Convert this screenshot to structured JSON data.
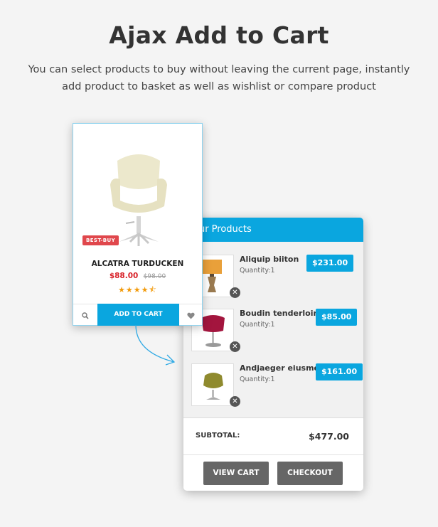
{
  "header": {
    "title": "Ajax Add to Cart",
    "subtitle_line1": "You can select products to buy without leaving the current page, instantly",
    "subtitle_line2": "add product to basket as well as wishlist or compare product"
  },
  "product_card": {
    "badge": "BEST-BUY",
    "name": "ALCATRA TURDUCKEN",
    "price": "$88.00",
    "old_price": "$98.00",
    "rating": 4.5,
    "rating_max": 5,
    "stars_display": "★★★★⯪",
    "add_to_cart_label": "ADD TO CART",
    "search_icon": "search-icon",
    "wishlist_icon": "heart-icon"
  },
  "cart": {
    "header_title": "our Products",
    "items": [
      {
        "name": "Aliquip biiton",
        "quantity": "Quantity:1",
        "price": "$231.00",
        "thumb": "lamp"
      },
      {
        "name": "Boudin tenderloin",
        "quantity": "Quantity:1",
        "price": "$85.00",
        "thumb": "red-chair"
      },
      {
        "name": "Andjaeger eiusmo",
        "quantity": "Quantity:1",
        "price": "$161.00",
        "thumb": "olive-chair"
      }
    ],
    "remove_glyph": "✕",
    "subtotal_label": "SUBTOTAL:",
    "subtotal_value": "$477.00",
    "view_cart_label": "VIEW CART",
    "checkout_label": "CHECKOUT"
  },
  "colors": {
    "accent": "#0aa6df",
    "sale_price": "#d8232a",
    "badge": "#e0474c",
    "star": "#f29b0c",
    "dark_button": "#666666"
  }
}
